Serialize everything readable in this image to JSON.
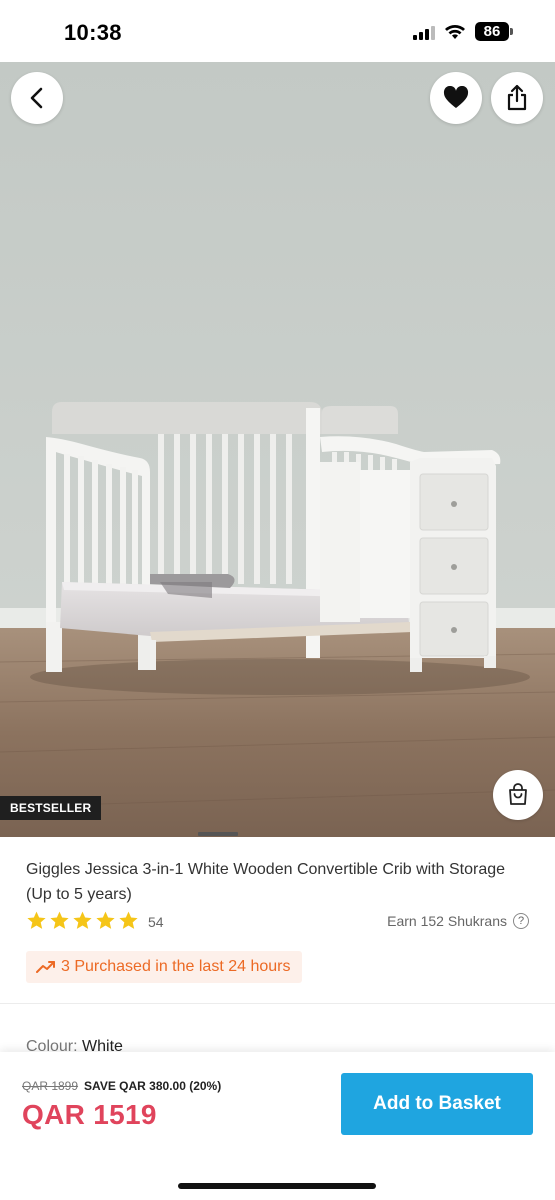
{
  "status_bar": {
    "time": "10:38",
    "battery": "86"
  },
  "product_image": {
    "badge": "BESTSELLER",
    "icons": [
      "back-arrow-icon",
      "heart-icon",
      "share-icon",
      "shopping-bag-icon"
    ]
  },
  "product": {
    "title": "Giggles Jessica 3-in-1 White Wooden Convertible Crib with Storage (Up to 5 years)",
    "rating": 5,
    "review_count": "54",
    "shukrans_text": "Earn 152 Shukrans",
    "help_symbol": "?",
    "purchased_text": "3 Purchased in the last 24 hours",
    "colour_label": "Colour:",
    "colour_value": "White"
  },
  "purchase_bar": {
    "old_price": "QAR 1899",
    "save_text": "SAVE QAR 380.00 (20%)",
    "current_price": "QAR 1519",
    "add_button_label": "Add to Basket"
  },
  "colors": {
    "price_red": "#e0445c",
    "button_blue": "#1fa5e0",
    "trend_orange": "#ec6a25",
    "star_yellow": "#f5c518"
  }
}
